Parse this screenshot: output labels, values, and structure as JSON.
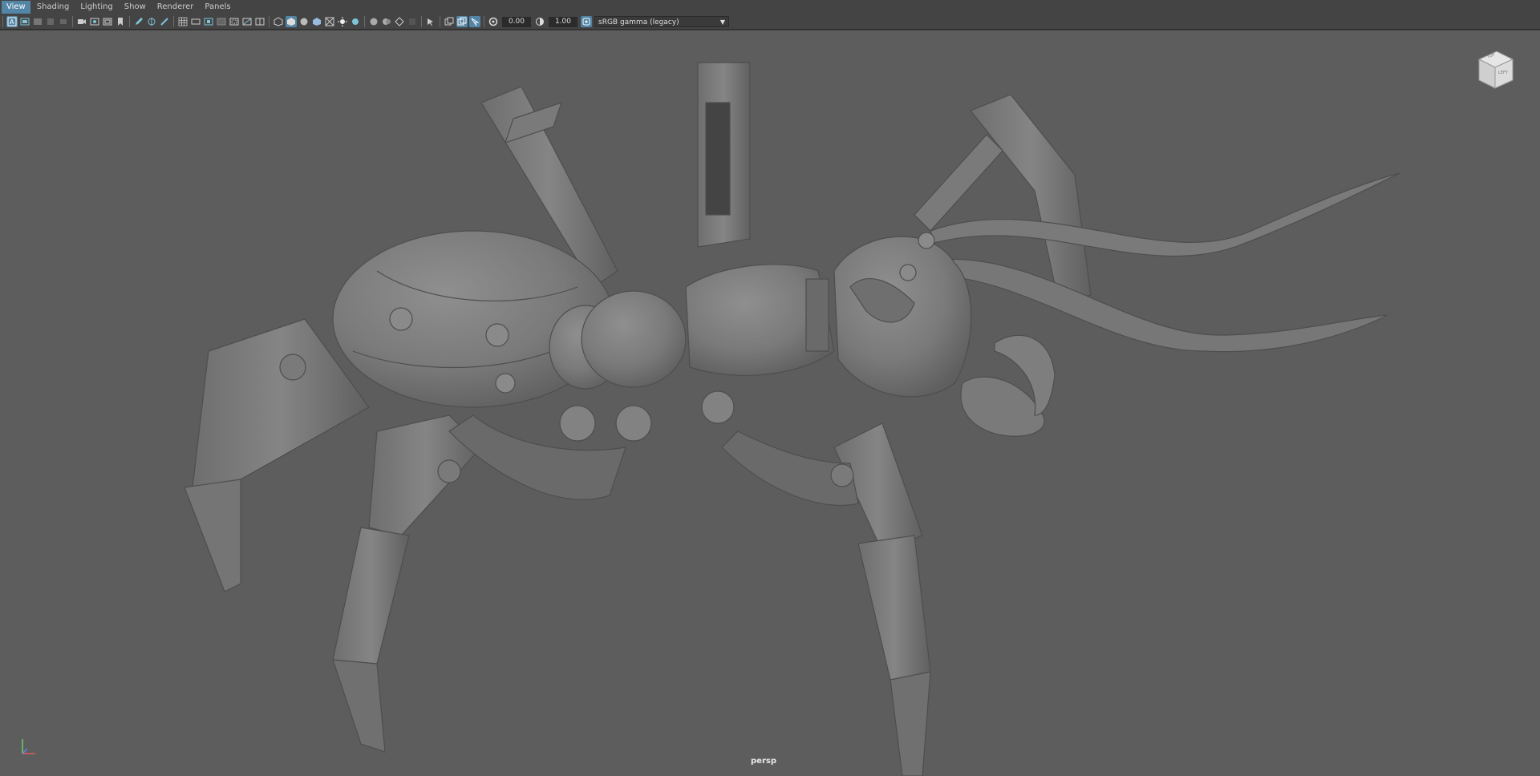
{
  "menus": [
    {
      "label": "View",
      "active": true
    },
    {
      "label": "Shading",
      "active": false
    },
    {
      "label": "Lighting",
      "active": false
    },
    {
      "label": "Show",
      "active": false
    },
    {
      "label": "Renderer",
      "active": false
    },
    {
      "label": "Panels",
      "active": false
    }
  ],
  "toolbar": {
    "exposure_value": "0.00",
    "gamma_value": "1.00",
    "color_space": "sRGB gamma (legacy)"
  },
  "viewport": {
    "camera_name": "persp",
    "viewcube_top": "TOP",
    "viewcube_left": "LEFT"
  },
  "colors": {
    "accent": "#5285a6",
    "viewport_bg": "#5d5d5d",
    "chrome_bg": "#444444"
  }
}
